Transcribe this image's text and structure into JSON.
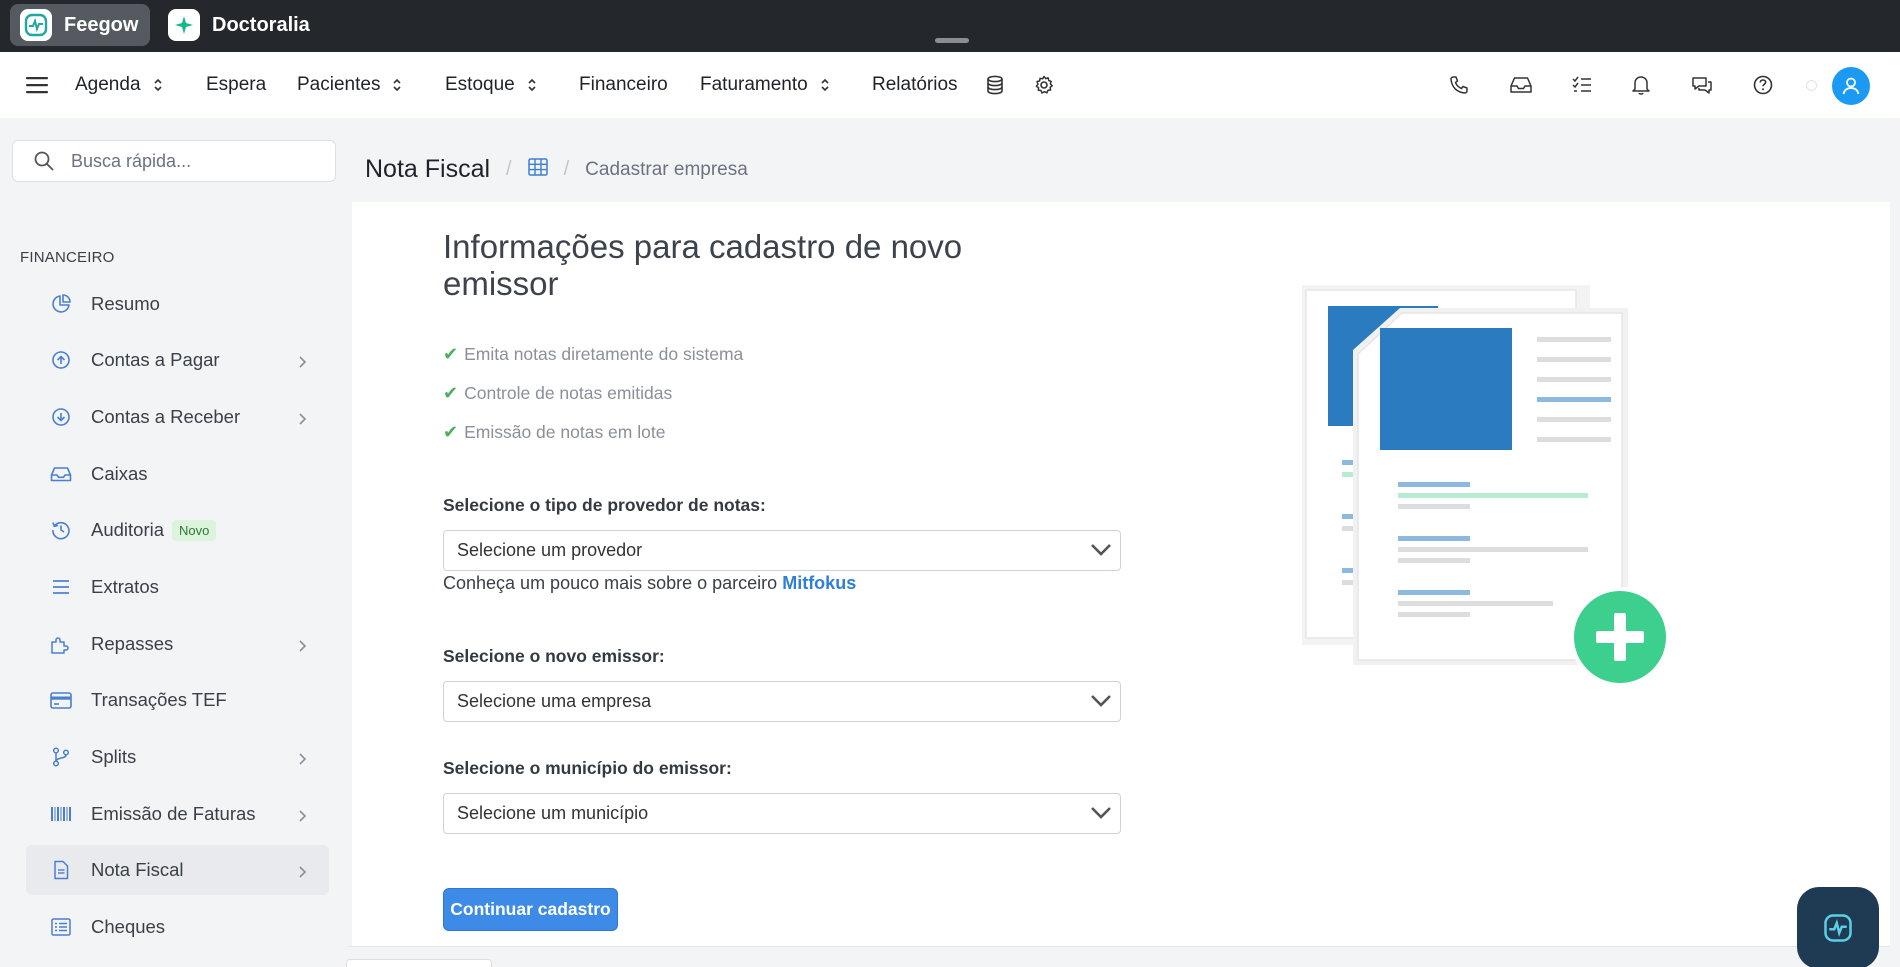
{
  "browser_tabs": [
    {
      "label": "Feegow",
      "active": true
    },
    {
      "label": "Doctoralia",
      "active": false
    }
  ],
  "nav": {
    "items": [
      {
        "label": "Agenda",
        "dropdown": true
      },
      {
        "label": "Espera",
        "dropdown": false
      },
      {
        "label": "Pacientes",
        "dropdown": true
      },
      {
        "label": "Estoque",
        "dropdown": true
      },
      {
        "label": "Financeiro",
        "dropdown": false
      },
      {
        "label": "Faturamento",
        "dropdown": true
      },
      {
        "label": "Relatórios",
        "dropdown": false
      }
    ],
    "right_icons": [
      "phone-icon",
      "inbox-icon",
      "tasks-icon",
      "bell-icon",
      "chat-icon",
      "help-icon"
    ]
  },
  "sidebar": {
    "search_placeholder": "Busca rápida...",
    "section_title": "FINANCEIRO",
    "items": [
      {
        "label": "Resumo",
        "icon": "pie-chart-icon",
        "chevron": false
      },
      {
        "label": "Contas a Pagar",
        "icon": "arrow-up-circle-icon",
        "chevron": true
      },
      {
        "label": "Contas a Receber",
        "icon": "arrow-down-circle-icon",
        "chevron": true
      },
      {
        "label": "Caixas",
        "icon": "inbox-icon",
        "chevron": false
      },
      {
        "label": "Auditoria",
        "icon": "history-icon",
        "chevron": false,
        "badge": "Novo"
      },
      {
        "label": "Extratos",
        "icon": "list-icon",
        "chevron": false
      },
      {
        "label": "Repasses",
        "icon": "puzzle-icon",
        "chevron": true
      },
      {
        "label": "Transações TEF",
        "icon": "credit-card-icon",
        "chevron": false
      },
      {
        "label": "Splits",
        "icon": "branch-icon",
        "chevron": true
      },
      {
        "label": "Emissão de Faturas",
        "icon": "barcode-icon",
        "chevron": true
      },
      {
        "label": "Nota Fiscal",
        "icon": "file-icon",
        "chevron": true,
        "active": true
      },
      {
        "label": "Cheques",
        "icon": "list-alt-icon",
        "chevron": false
      }
    ]
  },
  "breadcrumb": {
    "title": "Nota Fiscal",
    "current": "Cadastrar empresa"
  },
  "form": {
    "heading": "Informações para cadastro de novo emissor",
    "features": [
      "Emita notas diretamente do sistema",
      "Controle de notas emitidas",
      "Emissão de notas em lote"
    ],
    "provider_label": "Selecione o tipo de provedor de notas:",
    "provider_value": "Selecione um provedor",
    "help_text": "Conheça um pouco mais sobre o parceiro",
    "help_link": "Mitfokus",
    "issuer_label": "Selecione o novo emissor:",
    "issuer_value": "Selecione uma empresa",
    "city_label": "Selecione o município do emissor:",
    "city_value": "Selecione um município",
    "submit_label": "Continuar cadastro"
  },
  "colors": {
    "accent_blue": "#3d8be6",
    "illustration_blue": "#2a7bbf",
    "plus_green": "#3ccf8e",
    "check_green": "#4caf62",
    "link_blue": "#2f7fd6"
  }
}
